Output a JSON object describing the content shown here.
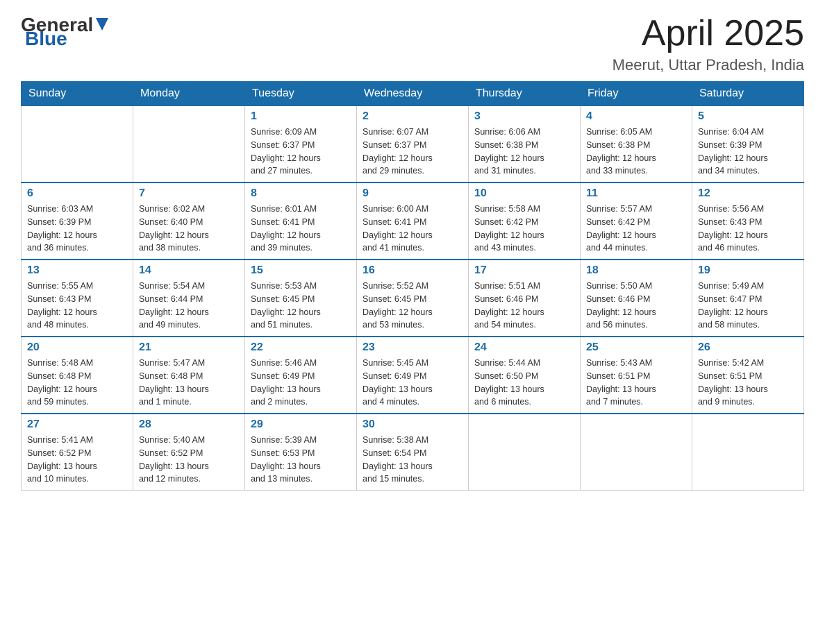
{
  "header": {
    "logo_general": "General",
    "logo_blue": "Blue",
    "title": "April 2025",
    "subtitle": "Meerut, Uttar Pradesh, India"
  },
  "days_of_week": [
    "Sunday",
    "Monday",
    "Tuesday",
    "Wednesday",
    "Thursday",
    "Friday",
    "Saturday"
  ],
  "weeks": [
    [
      {
        "day": "",
        "info": ""
      },
      {
        "day": "",
        "info": ""
      },
      {
        "day": "1",
        "info": "Sunrise: 6:09 AM\nSunset: 6:37 PM\nDaylight: 12 hours\nand 27 minutes."
      },
      {
        "day": "2",
        "info": "Sunrise: 6:07 AM\nSunset: 6:37 PM\nDaylight: 12 hours\nand 29 minutes."
      },
      {
        "day": "3",
        "info": "Sunrise: 6:06 AM\nSunset: 6:38 PM\nDaylight: 12 hours\nand 31 minutes."
      },
      {
        "day": "4",
        "info": "Sunrise: 6:05 AM\nSunset: 6:38 PM\nDaylight: 12 hours\nand 33 minutes."
      },
      {
        "day": "5",
        "info": "Sunrise: 6:04 AM\nSunset: 6:39 PM\nDaylight: 12 hours\nand 34 minutes."
      }
    ],
    [
      {
        "day": "6",
        "info": "Sunrise: 6:03 AM\nSunset: 6:39 PM\nDaylight: 12 hours\nand 36 minutes."
      },
      {
        "day": "7",
        "info": "Sunrise: 6:02 AM\nSunset: 6:40 PM\nDaylight: 12 hours\nand 38 minutes."
      },
      {
        "day": "8",
        "info": "Sunrise: 6:01 AM\nSunset: 6:41 PM\nDaylight: 12 hours\nand 39 minutes."
      },
      {
        "day": "9",
        "info": "Sunrise: 6:00 AM\nSunset: 6:41 PM\nDaylight: 12 hours\nand 41 minutes."
      },
      {
        "day": "10",
        "info": "Sunrise: 5:58 AM\nSunset: 6:42 PM\nDaylight: 12 hours\nand 43 minutes."
      },
      {
        "day": "11",
        "info": "Sunrise: 5:57 AM\nSunset: 6:42 PM\nDaylight: 12 hours\nand 44 minutes."
      },
      {
        "day": "12",
        "info": "Sunrise: 5:56 AM\nSunset: 6:43 PM\nDaylight: 12 hours\nand 46 minutes."
      }
    ],
    [
      {
        "day": "13",
        "info": "Sunrise: 5:55 AM\nSunset: 6:43 PM\nDaylight: 12 hours\nand 48 minutes."
      },
      {
        "day": "14",
        "info": "Sunrise: 5:54 AM\nSunset: 6:44 PM\nDaylight: 12 hours\nand 49 minutes."
      },
      {
        "day": "15",
        "info": "Sunrise: 5:53 AM\nSunset: 6:45 PM\nDaylight: 12 hours\nand 51 minutes."
      },
      {
        "day": "16",
        "info": "Sunrise: 5:52 AM\nSunset: 6:45 PM\nDaylight: 12 hours\nand 53 minutes."
      },
      {
        "day": "17",
        "info": "Sunrise: 5:51 AM\nSunset: 6:46 PM\nDaylight: 12 hours\nand 54 minutes."
      },
      {
        "day": "18",
        "info": "Sunrise: 5:50 AM\nSunset: 6:46 PM\nDaylight: 12 hours\nand 56 minutes."
      },
      {
        "day": "19",
        "info": "Sunrise: 5:49 AM\nSunset: 6:47 PM\nDaylight: 12 hours\nand 58 minutes."
      }
    ],
    [
      {
        "day": "20",
        "info": "Sunrise: 5:48 AM\nSunset: 6:48 PM\nDaylight: 12 hours\nand 59 minutes."
      },
      {
        "day": "21",
        "info": "Sunrise: 5:47 AM\nSunset: 6:48 PM\nDaylight: 13 hours\nand 1 minute."
      },
      {
        "day": "22",
        "info": "Sunrise: 5:46 AM\nSunset: 6:49 PM\nDaylight: 13 hours\nand 2 minutes."
      },
      {
        "day": "23",
        "info": "Sunrise: 5:45 AM\nSunset: 6:49 PM\nDaylight: 13 hours\nand 4 minutes."
      },
      {
        "day": "24",
        "info": "Sunrise: 5:44 AM\nSunset: 6:50 PM\nDaylight: 13 hours\nand 6 minutes."
      },
      {
        "day": "25",
        "info": "Sunrise: 5:43 AM\nSunset: 6:51 PM\nDaylight: 13 hours\nand 7 minutes."
      },
      {
        "day": "26",
        "info": "Sunrise: 5:42 AM\nSunset: 6:51 PM\nDaylight: 13 hours\nand 9 minutes."
      }
    ],
    [
      {
        "day": "27",
        "info": "Sunrise: 5:41 AM\nSunset: 6:52 PM\nDaylight: 13 hours\nand 10 minutes."
      },
      {
        "day": "28",
        "info": "Sunrise: 5:40 AM\nSunset: 6:52 PM\nDaylight: 13 hours\nand 12 minutes."
      },
      {
        "day": "29",
        "info": "Sunrise: 5:39 AM\nSunset: 6:53 PM\nDaylight: 13 hours\nand 13 minutes."
      },
      {
        "day": "30",
        "info": "Sunrise: 5:38 AM\nSunset: 6:54 PM\nDaylight: 13 hours\nand 15 minutes."
      },
      {
        "day": "",
        "info": ""
      },
      {
        "day": "",
        "info": ""
      },
      {
        "day": "",
        "info": ""
      }
    ]
  ]
}
